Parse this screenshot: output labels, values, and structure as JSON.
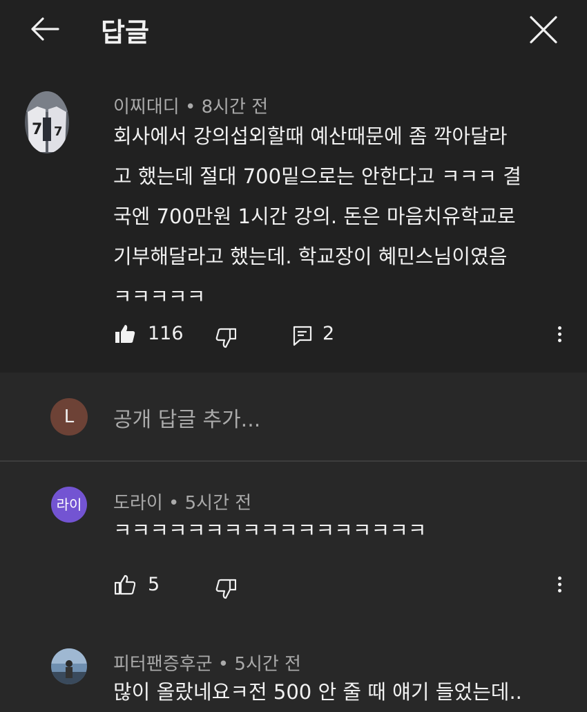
{
  "header": {
    "title": "답글",
    "back_icon": "arrow-left-icon",
    "close_icon": "close-icon"
  },
  "main_comment": {
    "author": "이찌대디",
    "time": "8시간 전",
    "text": "회사에서 강의섭외할때 예산때문에 좀 깍아달라\n고 했는데 절대 700밑으로는 안한다고 ㅋㅋㅋ 결\n국엔 700만원 1시간 강의. 돈은 마음치유학교로\n기부해달라고 했는데. 학교장이 혜민스님이였음\nㅋㅋㅋㅋㅋ",
    "likes": "116",
    "replies_count": "2",
    "liked": true
  },
  "add_reply": {
    "avatar_letter": "L",
    "placeholder": "공개 답글 추가..."
  },
  "replies": [
    {
      "avatar_text": "라이",
      "author": "도라이",
      "time": "5시간 전",
      "text": "ㅋㅋㅋㅋㅋㅋㅋㅋㅋㅋㅋㅋㅋㅋㅋㅋㅋ",
      "likes": "5"
    },
    {
      "author": "피터팬증후군",
      "time": "5시간 전",
      "text": "많이 올랐네요ㅋ전 500 안 줄 때 얘기 들었는데.."
    }
  ],
  "colors": {
    "background": "#282828",
    "header": "#212121",
    "text": "#f1f1f1",
    "secondary_text": "#aaaaaa",
    "reply_avatar": "#7354d2",
    "letter_avatar": "#6d4236"
  }
}
